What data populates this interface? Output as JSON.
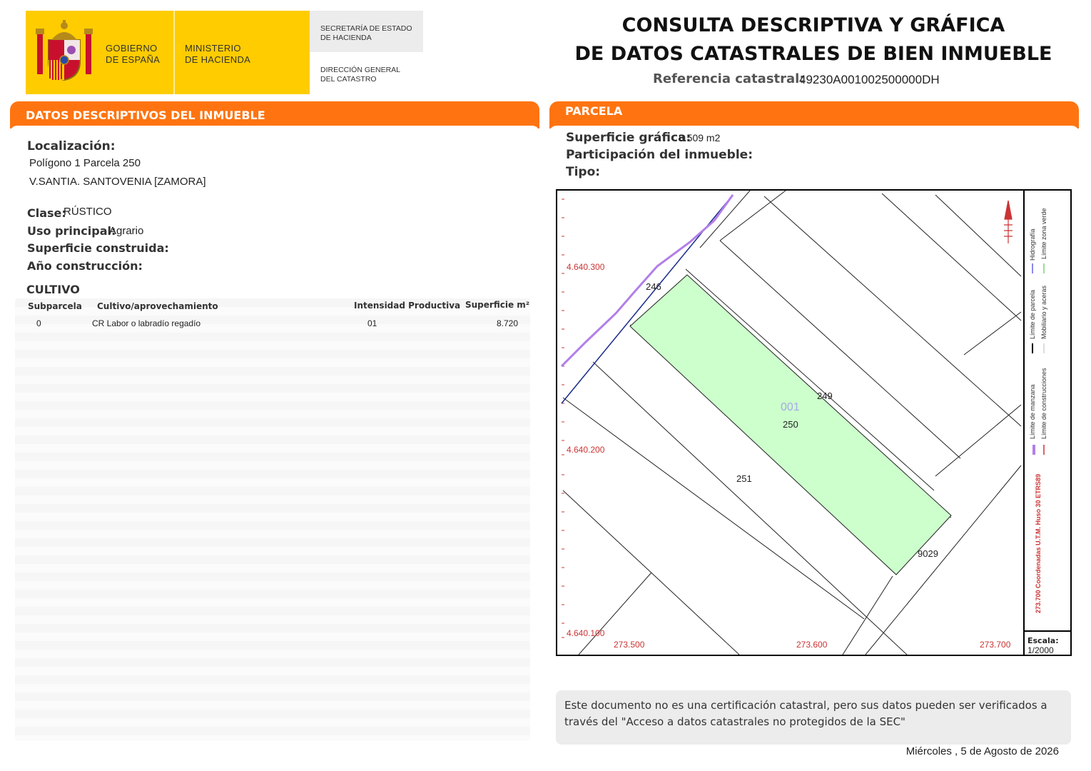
{
  "header": {
    "gov_line1": "GOBIERNO",
    "gov_line2": "DE ESPAÑA",
    "ministry_line1": "MINISTERIO",
    "ministry_line2": "DE HACIENDA",
    "secretaria_line1": "SECRETARÍA DE ESTADO",
    "secretaria_line2": "DE HACIENDA",
    "direccion_line1": "DIRECCIÓN GENERAL",
    "direccion_line2": "DEL CATASTRO",
    "title_line1": "CONSULTA DESCRIPTIVA Y GRÁFICA",
    "title_line2": "DE DATOS CATASTRALES DE BIEN INMUEBLE",
    "ref_label": "Referencia catastral:",
    "ref_value": "49230A001002500000DH"
  },
  "descriptivos": {
    "heading": "DATOS DESCRIPTIVOS DEL INMUEBLE",
    "localizacion_label": "Localización:",
    "localizacion_line1": "Polígono 1 Parcela 250",
    "localizacion_line2": "V.SANTIA. SANTOVENIA [ZAMORA]",
    "clase_label": "Clase:",
    "clase_value": "RÚSTICO",
    "uso_label": "Uso principal:",
    "uso_value": "Agrario",
    "superficie_construida_label": "Superficie construida:",
    "anio_label": "Año construcción:",
    "cultivo_heading": "CULTIVO",
    "table": {
      "headers": [
        "Subparcela",
        "Cultivo/aprovechamiento",
        "Intensidad Productiva",
        "Superficie m²"
      ],
      "rows": [
        {
          "subparcela": "0",
          "cultivo": "CR Labor o labradío regadío",
          "intensidad": "01",
          "superficie": "8.720"
        }
      ]
    }
  },
  "parcela": {
    "heading": "PARCELA",
    "superficie_label": "Superficie gráfica:",
    "superficie_value": "8.509 m2",
    "participacion_label": "Participación del inmueble:",
    "tipo_label": "Tipo:",
    "map": {
      "y_labels": [
        "4.640.300",
        "4.640.200",
        "4.640.100"
      ],
      "x_labels": [
        "273.500",
        "273.600",
        "273.700"
      ],
      "parcel_labels": [
        "246",
        "249",
        "001",
        "250",
        "251",
        "9029"
      ],
      "legend": {
        "col1": [
          "Límite de manzana",
          "Límite de parcela",
          "Hidrografía"
        ],
        "col2": [
          "Límite de construcciones",
          "Mobiliario y aceras",
          "Límite zona verde"
        ],
        "coords": "273.700 Coordenadas U.T.M. Huso 30 ETRS89"
      },
      "scale_label": "Escala:",
      "scale_value": "1/2000",
      "colors": {
        "parcel_fill": "#ccffcc",
        "hydro": "#b27fe8",
        "manzana": "#1a2a8c",
        "grid_red": "#cc3333"
      }
    }
  },
  "footer": {
    "note": "Este documento no es una certificación catastral, pero sus datos pueden ser verificados a través del \"Acceso a datos catastrales no protegidos de la SEC\"",
    "date": "Miércoles , 5 de Agosto de 2026"
  }
}
